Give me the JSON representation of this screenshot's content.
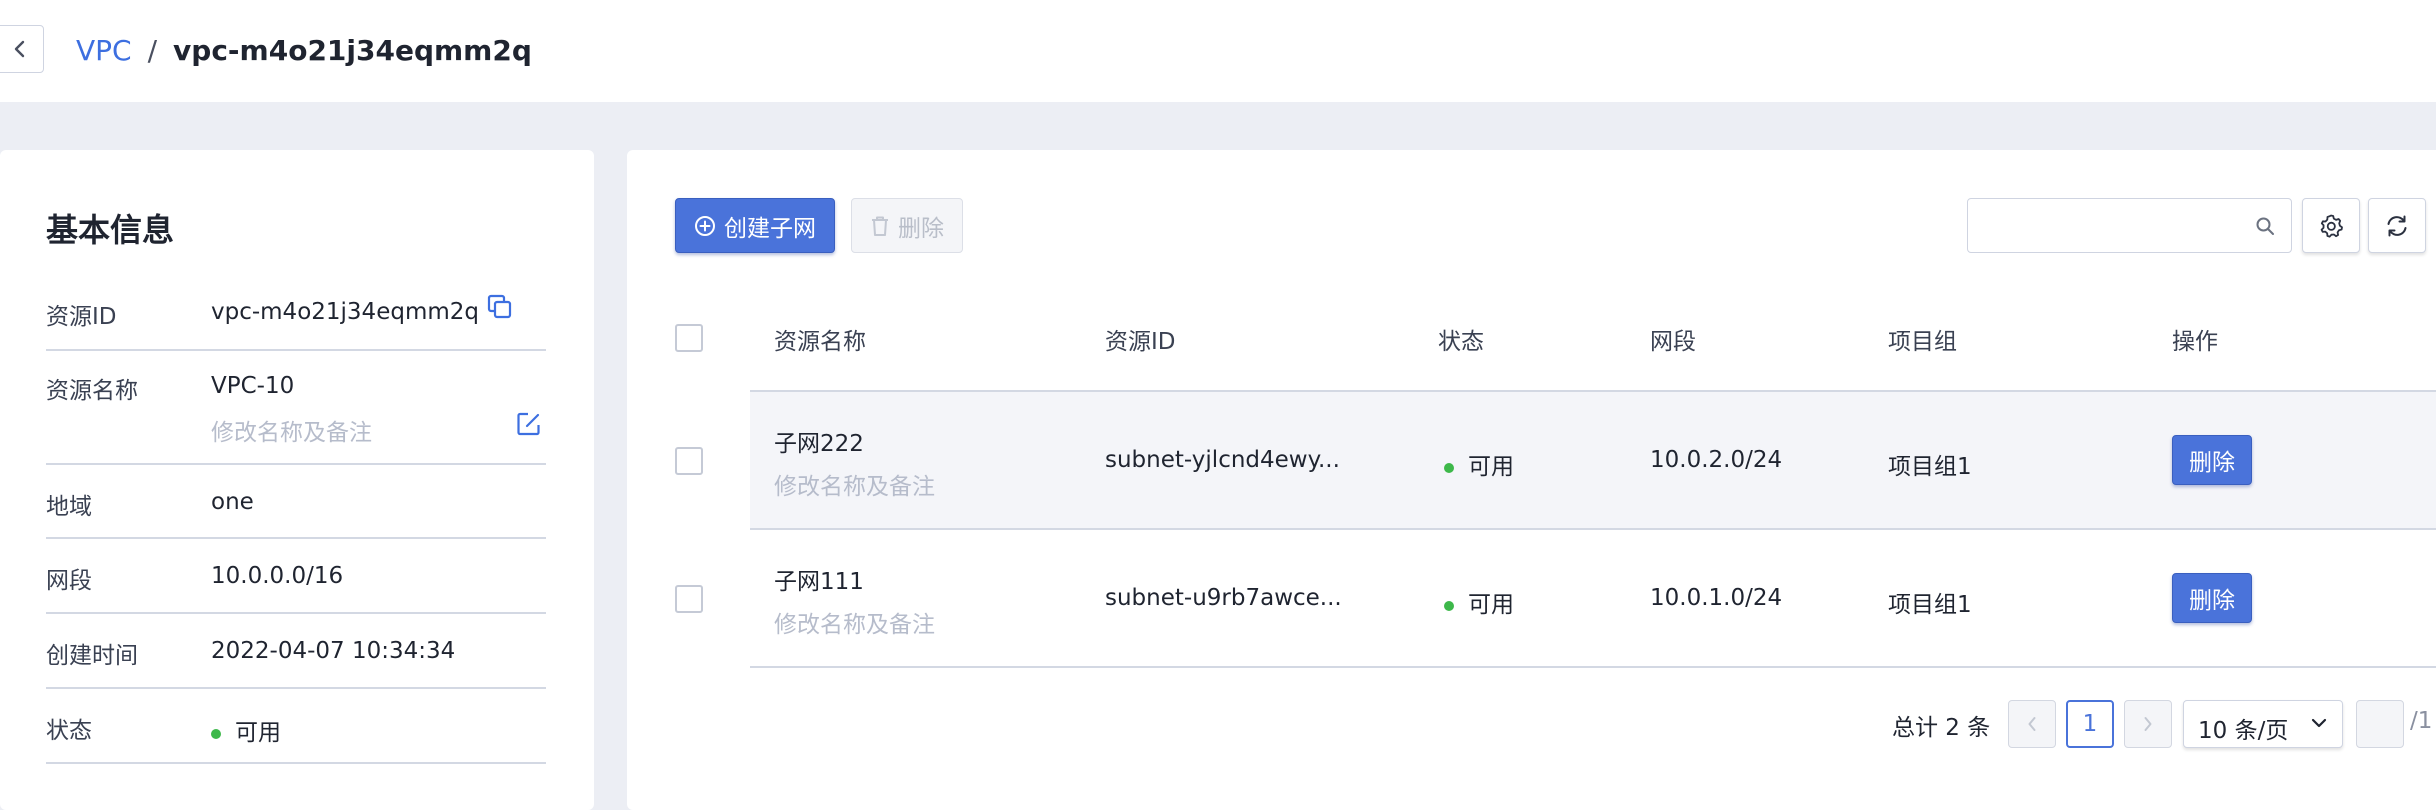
{
  "breadcrumb": {
    "parent": "VPC",
    "separator": "/",
    "current": "vpc-m4o21j34eqmm2q"
  },
  "basic_info": {
    "title": "基本信息",
    "rows": [
      {
        "label": "资源ID",
        "value": "vpc-m4o21j34eqmm2q"
      },
      {
        "label": "资源名称",
        "value": "VPC-10",
        "sub": "修改名称及备注"
      },
      {
        "label": "地域",
        "value": "one"
      },
      {
        "label": "网段",
        "value": "10.0.0.0/16"
      },
      {
        "label": "创建时间",
        "value": "2022-04-07 10:34:34"
      },
      {
        "label": "状态",
        "value": "可用"
      }
    ]
  },
  "toolbar": {
    "create_label": "创建子网",
    "delete_label": "删除",
    "search_placeholder": ""
  },
  "table": {
    "headers": [
      "资源名称",
      "资源ID",
      "状态",
      "网段",
      "项目组",
      "操作"
    ],
    "rows": [
      {
        "name": "子网222",
        "note": "修改名称及备注",
        "id": "subnet-yjlcnd4ewy...",
        "status": "可用",
        "cidr": "10.0.2.0/24",
        "group": "项目组1",
        "action": "删除"
      },
      {
        "name": "子网111",
        "note": "修改名称及备注",
        "id": "subnet-u9rb7awce...",
        "status": "可用",
        "cidr": "10.0.1.0/24",
        "group": "项目组1",
        "action": "删除"
      }
    ]
  },
  "pagination": {
    "total_text": "总计 2 条",
    "current_page": "1",
    "page_size": "10 条/页",
    "jump_value": "",
    "total_pages_suffix": "/1"
  },
  "colors": {
    "accent": "#4a73da",
    "link": "#3d6fe0",
    "status_ok": "#3db84a"
  },
  "icons": [
    "chevron-left-icon",
    "copy-icon",
    "edit-icon",
    "plus-circle-icon",
    "trash-icon",
    "search-icon",
    "gear-icon",
    "refresh-icon",
    "chevron-right-icon",
    "chevron-down-icon"
  ]
}
